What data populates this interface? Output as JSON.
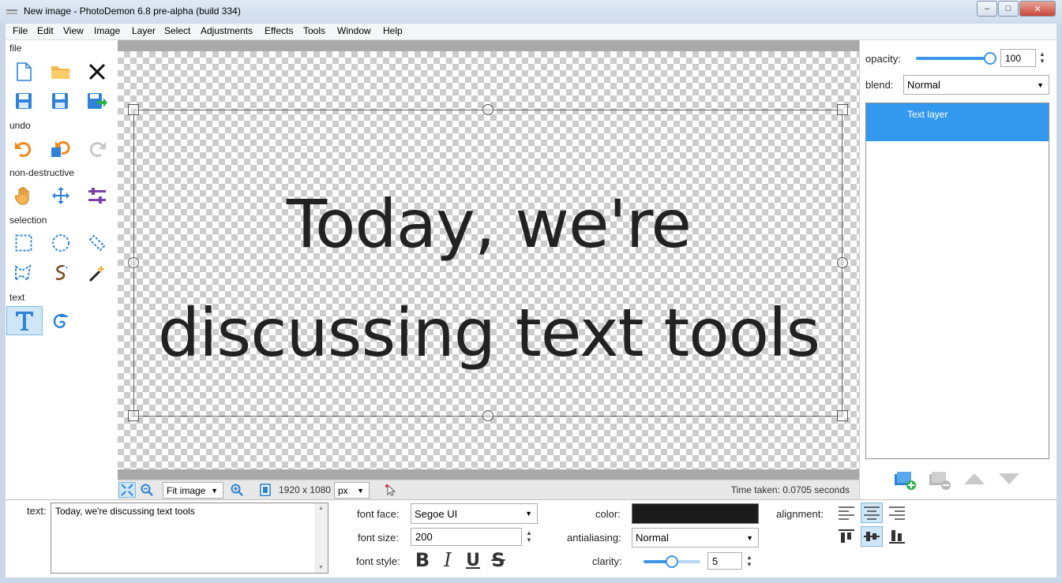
{
  "window": {
    "title": "New image  -  PhotoDemon 6.8 pre-alpha (build 334)",
    "min_glyph": "–",
    "max_glyph": "□",
    "close_glyph": "✕"
  },
  "menu": [
    "File",
    "Edit",
    "View",
    "Image",
    "Layer",
    "Select",
    "Adjustments",
    "Effects",
    "Tools",
    "Window",
    "Help"
  ],
  "toolbox": {
    "sections": {
      "file": "file",
      "undo": "undo",
      "nondestructive": "non-destructive",
      "selection": "selection",
      "text": "text"
    },
    "icons": [
      "new-image-icon",
      "open-folder-icon",
      "close-icon",
      "save-icon",
      "save-copy-icon",
      "export-icon",
      "undo-icon",
      "undo-history-icon",
      "redo-icon",
      "hand-icon",
      "move-icon",
      "quick-fix-sliders-icon",
      "rect-select-icon",
      "ellipse-select-icon",
      "line-select-icon",
      "polygon-select-icon",
      "lasso-select-icon",
      "magic-wand-icon",
      "text-tool-icon",
      "typography-tool-icon"
    ]
  },
  "canvas": {
    "line1": "Today, we're",
    "line2": "discussing text tools"
  },
  "statusbar": {
    "zoom_option": "Fit image",
    "image_size": "1920 x 1080",
    "unit": "px",
    "time_taken": "Time taken: 0.0705 seconds"
  },
  "layers_panel": {
    "opacity_label": "opacity:",
    "opacity_value": "100",
    "opacity_fraction": 1.0,
    "blend_label": "blend:",
    "blend_value": "Normal",
    "layers": [
      {
        "name": "Text layer",
        "selected": true
      }
    ]
  },
  "options": {
    "text_label": "text:",
    "text_value": "Today, we're discussing text tools",
    "font_face_label": "font face:",
    "font_face_value": "Segoe UI",
    "font_size_label": "font size:",
    "font_size_value": "200",
    "font_style_label": "font style:",
    "bold": "B",
    "italic": "I",
    "underline": "U",
    "strike": "S",
    "color_label": "color:",
    "color_value": "#1b1b1b",
    "antialiasing_label": "antialiasing:",
    "antialiasing_value": "Normal",
    "clarity_label": "clarity:",
    "clarity_value": "5",
    "alignment_label": "alignment:"
  },
  "colors": {
    "accent": "#3399ee",
    "active_tool_bg": "#cfe6f6"
  }
}
